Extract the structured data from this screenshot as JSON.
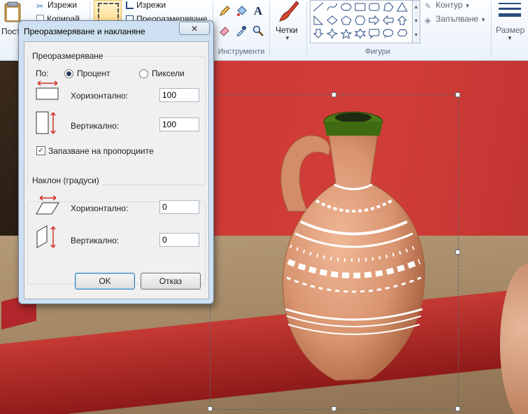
{
  "ribbon": {
    "paste_label": "Пост",
    "cut_label": "Изрежи",
    "copy_label": "Копирай",
    "crop_label": "Изрежи",
    "resize_label": "Преоразмеряване",
    "tools_group_label": "Инструменти",
    "brushes_label": "Четки",
    "shapes_group_label": "Фигури",
    "outline_label": "Контур",
    "fill_label": "Запълване",
    "size_label": "Размер"
  },
  "dialog": {
    "title": "Преоразмеряване и накланяне",
    "close_symbol": "✕",
    "resize_section": {
      "legend": "Преоразмеряване",
      "by_label": "По:",
      "percent_label": "Процент",
      "pixels_label": "Пиксели",
      "selected_unit": "percent",
      "horizontal_label": "Хоризонтално:",
      "horizontal_value": "100",
      "vertical_label": "Вертикално:",
      "vertical_value": "100",
      "keep_aspect_label": "Запазване на пропорциите",
      "keep_aspect_checked": true
    },
    "skew_section": {
      "legend": "Наклон (градуси)",
      "horizontal_label": "Хоризонтално:",
      "horizontal_value": "0",
      "vertical_label": "Вертикално:",
      "vertical_value": "0"
    },
    "ok_label": "OK",
    "cancel_label": "Отказ"
  },
  "colors": {
    "accent_red": "#d13d38",
    "arrow_red": "#d0342c",
    "selection_dash": "#5b6470"
  }
}
